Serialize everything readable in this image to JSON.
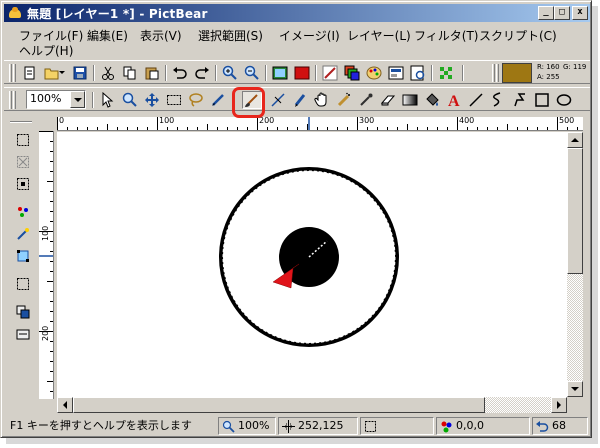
{
  "window": {
    "title": "無題 [レイヤー1 *] - PictBear",
    "minimize": "_",
    "maximize": "□",
    "close": "x"
  },
  "menu": [
    "ファイル(F)",
    "編集(E)",
    "表示(V)",
    "選択範囲(S)",
    "イメージ(I)",
    "レイヤー(L)",
    "フィルタ(T)",
    "スクリプト(C)",
    "ヘルプ(H)"
  ],
  "toolbar1": {
    "icons": [
      "new-file-icon",
      "open-folder-icon",
      "save-icon",
      "cut-icon",
      "copy-icon",
      "paste-icon",
      "undo-icon",
      "redo-icon",
      "zoom-in-icon",
      "zoom-out-icon",
      "image-icon",
      "fill-red-icon",
      "brush-settings-icon",
      "layers-icon",
      "palette-icon",
      "view-icon",
      "document-icon",
      "grid-icon"
    ],
    "color": {
      "hex": "#9e7713",
      "r_label": "R: 160",
      "g_label": "G: 119",
      "a_label": "A: 255"
    }
  },
  "toolbar2": {
    "zoom_value": "100%",
    "tools": [
      "select-arrow-icon",
      "magnifier-icon",
      "move-icon",
      "rect-select-icon",
      "lasso-icon",
      "pencil-icon",
      "brush-icon",
      "eraser-knife-icon",
      "pen-icon",
      "hand-icon",
      "airbrush-icon",
      "eyedropper-icon",
      "eraser-icon",
      "gradient-icon",
      "fill-bucket-icon",
      "text-icon",
      "line-icon",
      "curve-icon",
      "polyline-icon",
      "rectangle-icon",
      "ellipse-icon"
    ],
    "active_tool": "brush-icon",
    "highlight_color": "#e8261c"
  },
  "ruler": {
    "h_labels": [
      "0",
      "100",
      "200",
      "300",
      "400",
      "500"
    ],
    "v_labels": [
      "100",
      "200"
    ]
  },
  "statusbar": {
    "help_text": "F1 キーを押すとヘルプを表示します",
    "zoom": "100%",
    "cursor_pos": "252,125",
    "selection_size": "",
    "color_pos": "0,0,0",
    "history": "68"
  }
}
